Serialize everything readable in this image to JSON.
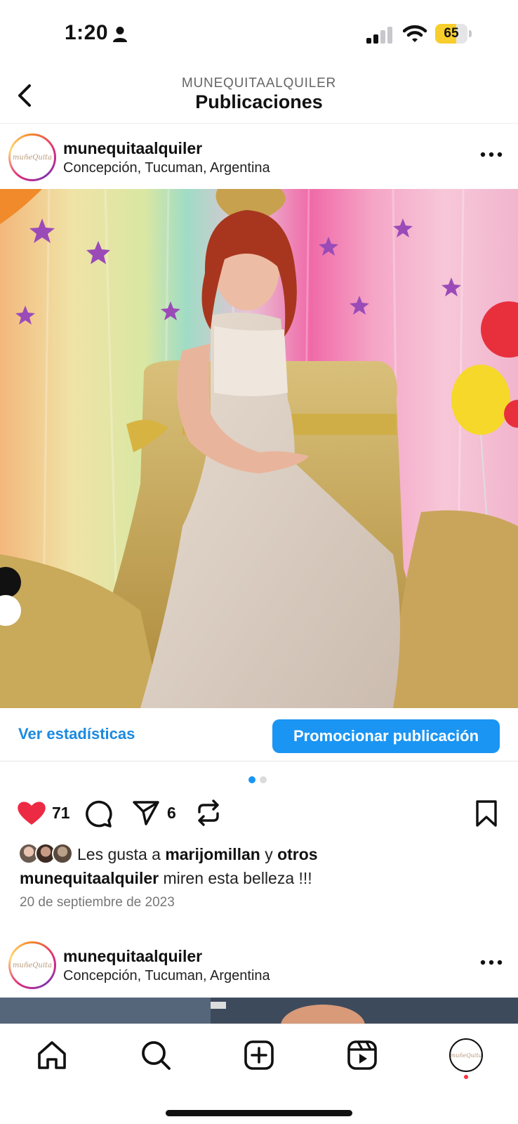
{
  "status_bar": {
    "time": "1:20",
    "battery": "65",
    "battery_level_percent": 65
  },
  "header": {
    "subtitle": "MUNEQUITAALQUILER",
    "title": "Publicaciones"
  },
  "posts": [
    {
      "username": "munequitaalquiler",
      "location": "Concepción, Tucuman, Argentina",
      "avatar_logo": "muñeQuita",
      "insights_label": "Ver estadísticas",
      "promote_label": "Promocionar publicación",
      "carousel_pages": 2,
      "carousel_current": 1,
      "likes_count": "71",
      "shares_count": "6",
      "likes_prefix": "Les gusta a",
      "liked_by": "marijomillan",
      "likes_joiner": "y",
      "likes_others": "otros",
      "caption_user": "munequitaalquiler",
      "caption_text": "miren esta belleza !!!",
      "date": "20 de septiembre de 2023"
    },
    {
      "username": "munequitaalquiler",
      "location": "Concepción, Tucuman, Argentina",
      "avatar_logo": "muñeQuita"
    }
  ],
  "tab_bar": {
    "items": [
      "home-icon",
      "search-icon",
      "create-icon",
      "reels-icon",
      "profile-avatar"
    ],
    "profile_logo": "muñeQuita"
  },
  "colors": {
    "accent_blue": "#1a95f3",
    "link_blue": "#1b8ae0",
    "like_red": "#ed2a43",
    "battery_yellow": "#f7ce2c"
  }
}
